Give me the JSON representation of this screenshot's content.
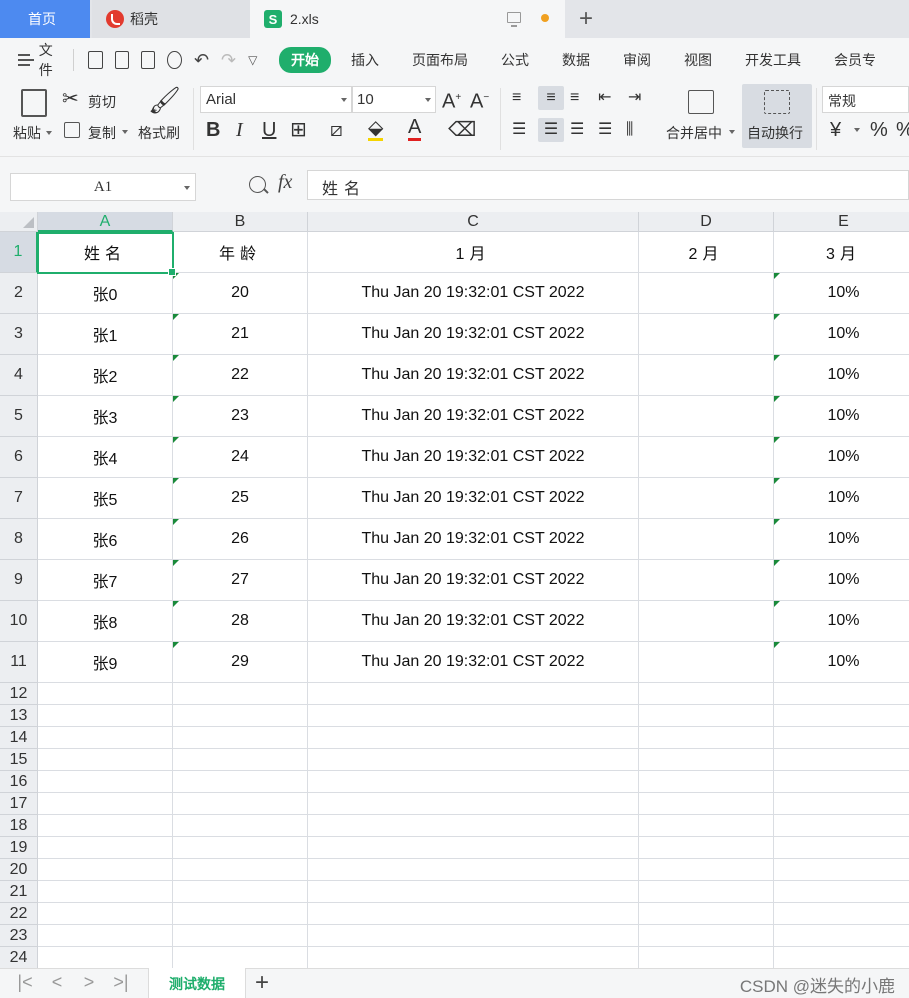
{
  "tabs": {
    "home": "首页",
    "daoke": "稻壳",
    "file": "2.xls",
    "file_icon_letter": "S"
  },
  "menu": {
    "file": "文件",
    "tabs": [
      "开始",
      "插入",
      "页面布局",
      "公式",
      "数据",
      "审阅",
      "视图",
      "开发工具",
      "会员专"
    ]
  },
  "ribbon": {
    "paste": "粘贴",
    "cut": "剪切",
    "copy": "复制",
    "format_painter": "格式刷",
    "font_name": "Arial",
    "font_size": "10",
    "merge_center": "合并居中",
    "wrap_text": "自动换行",
    "number_format": "常规",
    "currency_symbol": "¥",
    "percent_symbol": "%"
  },
  "formula_bar": {
    "name_box": "A1",
    "fx": "fx",
    "content": "姓名"
  },
  "grid": {
    "columns": [
      "A",
      "B",
      "C",
      "D",
      "E"
    ],
    "row_numbers": [
      "1",
      "2",
      "3",
      "4",
      "5",
      "6",
      "7",
      "8",
      "9",
      "10",
      "11",
      "12",
      "13",
      "14",
      "15",
      "16",
      "17",
      "18",
      "19",
      "20",
      "21",
      "22",
      "23",
      "24"
    ],
    "header_row": [
      "姓名",
      "年龄",
      "1月",
      "2月",
      "3月"
    ],
    "data_rows": [
      [
        "张0",
        "20",
        "Thu Jan 20 19:32:01 CST 2022",
        "",
        "10%"
      ],
      [
        "张1",
        "21",
        "Thu Jan 20 19:32:01 CST 2022",
        "",
        "10%"
      ],
      [
        "张2",
        "22",
        "Thu Jan 20 19:32:01 CST 2022",
        "",
        "10%"
      ],
      [
        "张3",
        "23",
        "Thu Jan 20 19:32:01 CST 2022",
        "",
        "10%"
      ],
      [
        "张4",
        "24",
        "Thu Jan 20 19:32:01 CST 2022",
        "",
        "10%"
      ],
      [
        "张5",
        "25",
        "Thu Jan 20 19:32:01 CST 2022",
        "",
        "10%"
      ],
      [
        "张6",
        "26",
        "Thu Jan 20 19:32:01 CST 2022",
        "",
        "10%"
      ],
      [
        "张7",
        "27",
        "Thu Jan 20 19:32:01 CST 2022",
        "",
        "10%"
      ],
      [
        "张8",
        "28",
        "Thu Jan 20 19:32:01 CST 2022",
        "",
        "10%"
      ],
      [
        "张9",
        "29",
        "Thu Jan 20 19:32:01 CST 2022",
        "",
        "10%"
      ]
    ]
  },
  "sheets": {
    "active": "测试数据",
    "add": "+"
  },
  "watermark": "CSDN @迷失的小鹿",
  "colors": {
    "accent": "#1fae6c",
    "home_tab": "#4d8af0"
  }
}
